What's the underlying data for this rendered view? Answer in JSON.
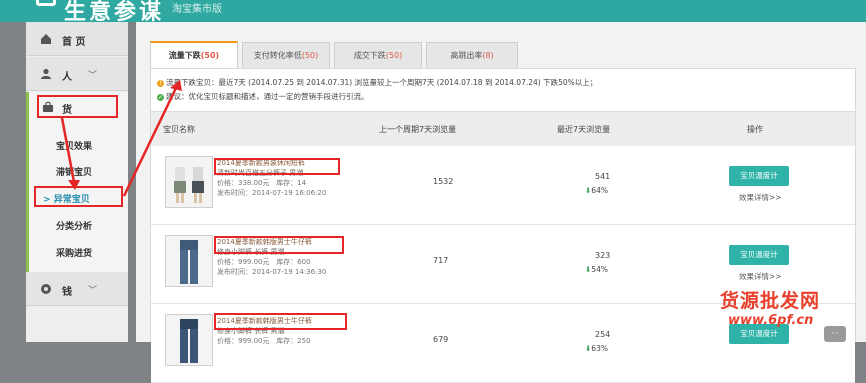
{
  "header": {
    "logo_text": "生意参谋",
    "logo_sub": "淘宝集市版"
  },
  "sidebar": {
    "home": "首 页",
    "people": "人",
    "goods": "货",
    "sub_items": [
      "宝贝效果",
      "滞销宝贝",
      "异常宝贝",
      "分类分析",
      "采购进货"
    ],
    "active_prefix": ">",
    "money": "钱",
    "chevron": "﹀"
  },
  "tabs": [
    {
      "label": "流量下跌",
      "count": "(50)"
    },
    {
      "label": "支付转化率低",
      "count": "(50)"
    },
    {
      "label": "成交下跌",
      "count": "(50)"
    },
    {
      "label": "高跳出率",
      "count": "(8)"
    }
  ],
  "notice": {
    "line1": "流量下跌宝贝：最近7天 (2014.07.25 到 2014.07.31) 浏览量较上一个周期7天 (2014.07.18 到 2014.07.24) 下跌50%以上；",
    "line2": "建议：优化宝贝标题和描述，通过一定的营销手段进行引流。"
  },
  "table": {
    "headers": [
      "宝贝名称",
      "上一个周期7天浏览量",
      "最近7天浏览量",
      "操作"
    ],
    "rows": [
      {
        "title1": "2014夏季新款男装休闲短裤",
        "title2": "清新时尚百搭五分裤子 男潮",
        "price": "价格：338.00元",
        "stock": "库存：14",
        "date": "发布时间：2014-07-19 16:06:20",
        "prev": "1532",
        "recent": "541",
        "change": "64%",
        "button": "宝贝温度计",
        "link": "效果详情>>"
      },
      {
        "title1": "2014夏季新款韩版男士牛仔裤",
        "title2": "修身小脚裤 长裤 男潮",
        "price": "价格：999.00元",
        "stock": "库存：600",
        "date": "发布时间：2014-07-19 14:36:30",
        "prev": "717",
        "recent": "323",
        "change": "54%",
        "button": "宝贝温度计",
        "link": "效果详情>>"
      },
      {
        "title1": "2014夏季新款韩版男士牛仔裤",
        "title2": "修身小脚裤 长裤 男潮",
        "price": "价格：999.00元",
        "stock": "库存：250",
        "date": "",
        "prev": "679",
        "recent": "254",
        "change": "63%",
        "button": "宝贝温度计",
        "link": ""
      }
    ]
  },
  "watermark": {
    "line1": "货源批发网",
    "line2": "www.6pf.cn"
  },
  "chat_icon": "···",
  "colors": {
    "accent": "#2ea8a0",
    "button": "#2fb3a8",
    "annotation": "#e52626",
    "active_tab": "#f39a1e",
    "decline": "#3aa35a"
  }
}
